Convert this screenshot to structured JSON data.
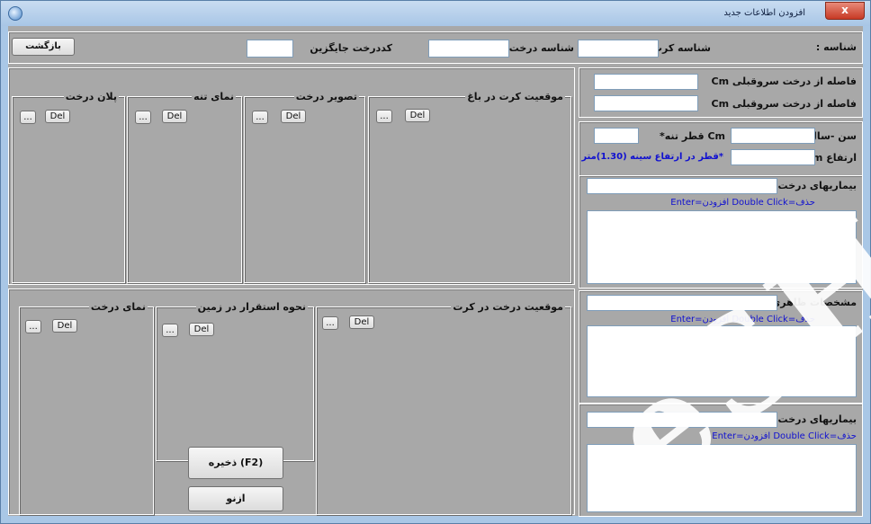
{
  "window": {
    "title": "افزودن اطلاعات جدید",
    "close_label": "x"
  },
  "header": {
    "id_label": "شناسه :",
    "card_id_label": "شناسه کرت",
    "tree_id_label": "شناسه درخت",
    "replace_code_label": "کددرخت جایگزین",
    "back_button": "بازگشت"
  },
  "distances": {
    "west_label": "فاصله از درخت سروقبلی Cm",
    "east_label": "فاصله از درخت سروقبلی Cm"
  },
  "measures": {
    "age_label": "سن -سال",
    "trunk_label": "Cm قطر تنه*",
    "height_label": "ارتفاع m",
    "note": "*قطر در ارتفاع سینه (1.30)متر"
  },
  "diseases": {
    "label": "بیماریهای درخت",
    "hint": "حذف=Double Click  افزودن=Enter"
  },
  "appearance": {
    "label": "مشخصات ظاهری",
    "hint": "حذف=Double Click  افزودن=Enter"
  },
  "diseases2": {
    "label": "بیماریهای درخت",
    "hint": "حذف=Double Click  افزودن=Enter"
  },
  "frames_top": [
    {
      "title": "موقعیت کرت در باغ",
      "browse": "...",
      "del": "Del"
    },
    {
      "title": "تصویر درخت",
      "browse": "...",
      "del": "Del"
    },
    {
      "title": "نمای تنه",
      "browse": "...",
      "del": "Del"
    },
    {
      "title": "پلان درخت",
      "browse": "...",
      "del": "Del"
    }
  ],
  "frames_bottom": [
    {
      "title": "موقعیت درخت در کرت",
      "browse": "...",
      "del": "Del"
    },
    {
      "title": "نحوه استقرار در زمین",
      "browse": "...",
      "del": "Del"
    },
    {
      "title": "نمای درخت",
      "browse": "...",
      "del": "Del"
    }
  ],
  "actions": {
    "save": "ذخیره (F2)",
    "again": "ازنو"
  },
  "watermark": "eSH"
}
